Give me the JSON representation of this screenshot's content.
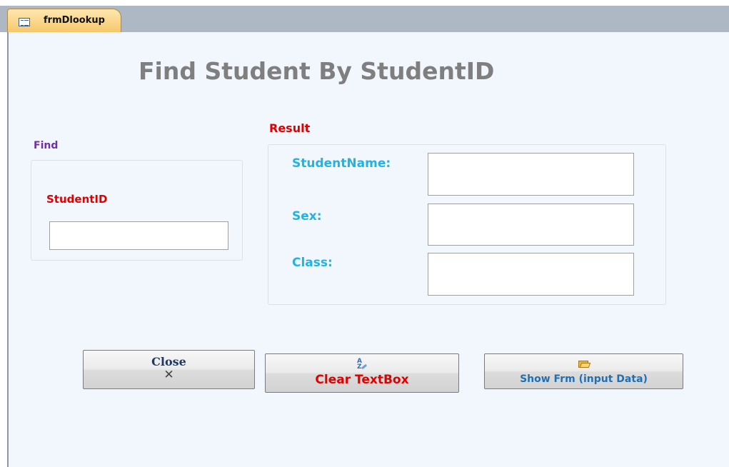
{
  "tab": {
    "label": "frmDlookup",
    "icon": "form-icon"
  },
  "form": {
    "title": "Find Student By StudentID",
    "find_group": {
      "caption": "Find",
      "studentid_label": "StudentID",
      "studentid_value": ""
    },
    "result_group": {
      "caption": "Result",
      "fields": [
        {
          "label": "StudentName:",
          "value": ""
        },
        {
          "label": "Sex:",
          "value": ""
        },
        {
          "label": "Class:",
          "value": ""
        }
      ]
    },
    "buttons": {
      "close": {
        "label": "Close",
        "icon_glyph": "✕"
      },
      "clear": {
        "label": "Clear TextBox",
        "icon": "sort-az-icon"
      },
      "show": {
        "label": "Show Frm (input Data)",
        "icon": "open-folder-icon"
      }
    }
  },
  "colors": {
    "title": "#7f7f7f",
    "find_caption": "#7030a0",
    "red_label": "#e00000",
    "cyan_label": "#1fb3e6",
    "close_label": "#1f3864",
    "show_label": "#1f6fb5",
    "form_bg": "#f1f7fd",
    "tab_bg": "#f6c86a"
  }
}
